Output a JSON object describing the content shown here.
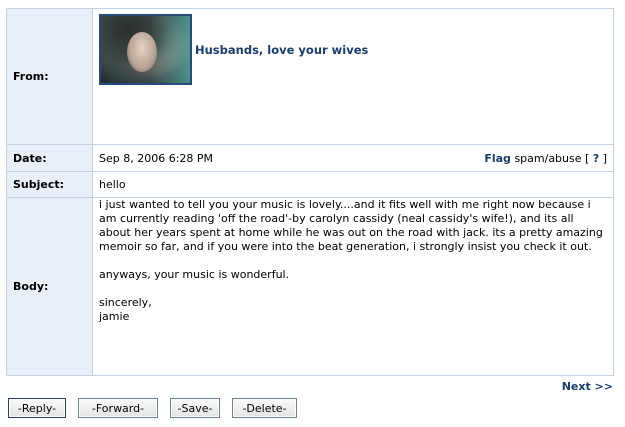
{
  "labels": {
    "from": "From:",
    "date": "Date:",
    "subject": "Subject:",
    "body": "Body:"
  },
  "message": {
    "sender_name": "Husbands, love your wives",
    "date": "Sep 8, 2006 6:28 PM",
    "subject": "hello",
    "body_paragraphs": [
      "i just wanted to tell you your music is lovely....and it fits well with me right now because i am currently reading 'off the road'-by carolyn cassidy (neal cassidy's wife!), and its all about her years spent at home while he was out on the road with jack. its a pretty amazing memoir so far, and if you were into the beat generation, i strongly insist you check it out.",
      "anyways, your music is wonderful.",
      "sincerely,\njamie"
    ]
  },
  "flag": {
    "flag_label": "Flag",
    "spam_label": "spam/abuse",
    "bracket_open": "[",
    "help_label": "?",
    "bracket_close": "]"
  },
  "nav": {
    "next_label": "Next >>"
  },
  "buttons": {
    "reply": "-Reply-",
    "forward": "-Forward-",
    "save": "-Save-",
    "delete": "-Delete-"
  },
  "icons": {
    "avatar": "sender-avatar-photo"
  }
}
